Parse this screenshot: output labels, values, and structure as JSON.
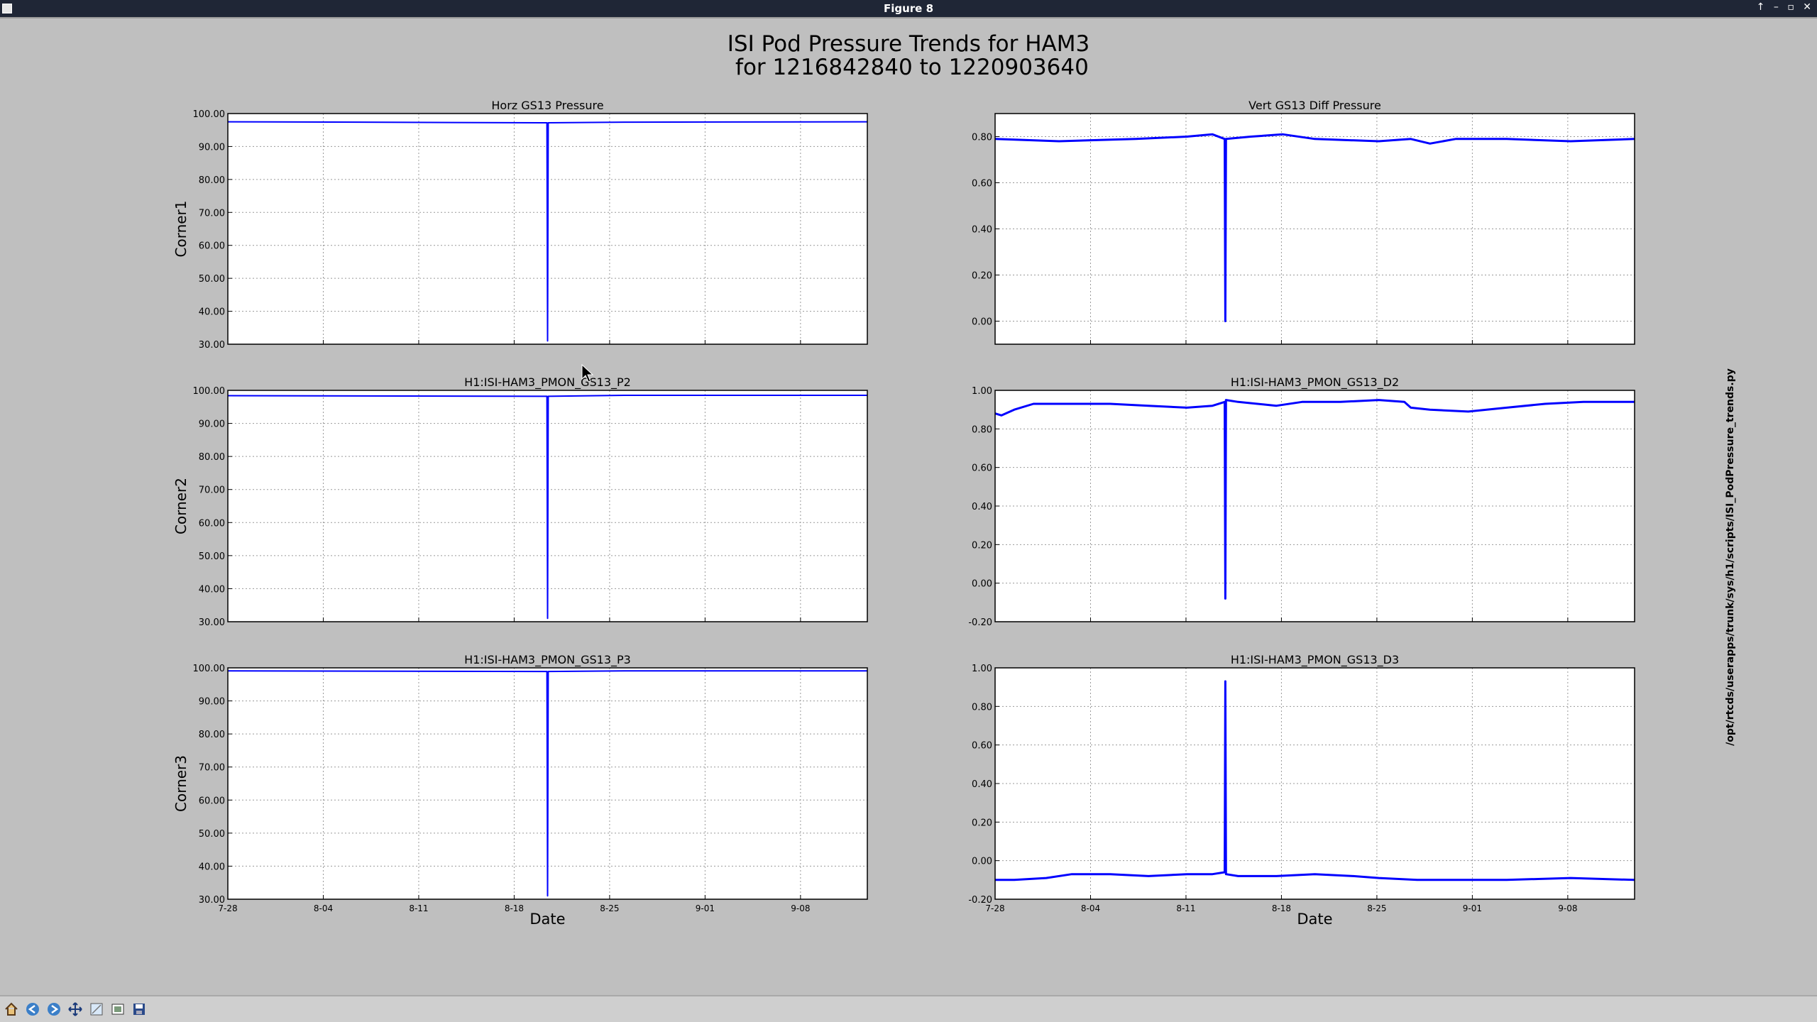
{
  "window": {
    "title": "Figure 8",
    "controls": [
      "↑",
      "–",
      "▫",
      "✕"
    ]
  },
  "figure": {
    "title_line1": "ISI Pod Pressure Trends for HAM3",
    "title_line2": " for 1216842840 to 1220903640",
    "side_text": "/opt/rtcds/userapps/trunk/sys/h1/scripts/ISI_PodPressure_trends.py"
  },
  "toolbar": {
    "icons": [
      "home-icon",
      "back-icon",
      "forward-icon",
      "pan-icon",
      "zoom-icon",
      "configure-icon",
      "save-icon"
    ]
  },
  "colors": {
    "line": "#0000ff",
    "background": "#bfbfbf",
    "plot_bg": "#ffffff"
  },
  "chart_data": [
    {
      "type": "line",
      "title": "Horz GS13 Pressure",
      "ylabel": "Corner1",
      "xlabel": "",
      "ylim": [
        30,
        100
      ],
      "yticks": [
        "30.00",
        "40.00",
        "50.00",
        "60.00",
        "70.00",
        "80.00",
        "90.00",
        "100.00"
      ],
      "xticks": [
        "7-28",
        "8-04",
        "8-11",
        "8-18",
        "8-25",
        "9-01",
        "9-08"
      ],
      "show_xticklabels": false,
      "grid": true,
      "series": [
        {
          "x": [
            0,
            49.9,
            50,
            50.1,
            62,
            100
          ],
          "y": [
            97.5,
            97.2,
            31,
            97.2,
            97.4,
            97.5
          ]
        }
      ]
    },
    {
      "type": "line",
      "title": "Vert GS13 Diff Pressure",
      "ylabel": "",
      "xlabel": "",
      "ylim": [
        -0.1,
        0.9
      ],
      "yticks": [
        "0.00",
        "0.20",
        "0.40",
        "0.60",
        "0.80"
      ],
      "xticks": [
        "7-28",
        "8-04",
        "8-11",
        "8-18",
        "8-25",
        "9-01",
        "9-08"
      ],
      "show_xticklabels": false,
      "grid": true,
      "series": [
        {
          "x": [
            0,
            10,
            22,
            30,
            34,
            35.9,
            36,
            36.1,
            40,
            45,
            50,
            60,
            65,
            68,
            72,
            80,
            90,
            100
          ],
          "y": [
            0.79,
            0.78,
            0.79,
            0.8,
            0.81,
            0.79,
            0.0,
            0.79,
            0.8,
            0.81,
            0.79,
            0.78,
            0.79,
            0.77,
            0.79,
            0.79,
            0.78,
            0.79
          ]
        }
      ]
    },
    {
      "type": "line",
      "title": "H1:ISI-HAM3_PMON_GS13_P2",
      "ylabel": "Corner2",
      "xlabel": "",
      "ylim": [
        30,
        100
      ],
      "yticks": [
        "30.00",
        "40.00",
        "50.00",
        "60.00",
        "70.00",
        "80.00",
        "90.00",
        "100.00"
      ],
      "xticks": [
        "7-28",
        "8-04",
        "8-11",
        "8-18",
        "8-25",
        "9-01",
        "9-08"
      ],
      "show_xticklabels": false,
      "grid": true,
      "series": [
        {
          "x": [
            0,
            49.9,
            50,
            50.1,
            62,
            100
          ],
          "y": [
            98.4,
            98.2,
            31,
            98.2,
            98.5,
            98.5
          ]
        }
      ]
    },
    {
      "type": "line",
      "title": "H1:ISI-HAM3_PMON_GS13_D2",
      "ylabel": "",
      "xlabel": "",
      "ylim": [
        -0.2,
        1.0
      ],
      "yticks": [
        "-0.20",
        "0.00",
        "0.20",
        "0.40",
        "0.60",
        "0.80",
        "1.00"
      ],
      "xticks": [
        "7-28",
        "8-04",
        "8-11",
        "8-18",
        "8-25",
        "9-01",
        "9-08"
      ],
      "show_xticklabels": false,
      "grid": true,
      "series": [
        {
          "x": [
            0,
            1,
            3,
            6,
            12,
            18,
            24,
            30,
            34,
            35.9,
            36,
            36.1,
            38,
            44,
            48,
            54,
            60,
            64,
            65,
            68,
            74,
            80,
            86,
            92,
            100
          ],
          "y": [
            0.88,
            0.87,
            0.9,
            0.93,
            0.93,
            0.93,
            0.92,
            0.91,
            0.92,
            0.94,
            -0.08,
            0.95,
            0.94,
            0.92,
            0.94,
            0.94,
            0.95,
            0.94,
            0.91,
            0.9,
            0.89,
            0.91,
            0.93,
            0.94,
            0.94
          ]
        }
      ]
    },
    {
      "type": "line",
      "title": "H1:ISI-HAM3_PMON_GS13_P3",
      "ylabel": "Corner3",
      "xlabel": "Date",
      "ylim": [
        30,
        100
      ],
      "yticks": [
        "30.00",
        "40.00",
        "50.00",
        "60.00",
        "70.00",
        "80.00",
        "90.00",
        "100.00"
      ],
      "xticks": [
        "7-28",
        "8-04",
        "8-11",
        "8-18",
        "8-25",
        "9-01",
        "9-08"
      ],
      "show_xticklabels": true,
      "grid": true,
      "series": [
        {
          "x": [
            0,
            49.9,
            50,
            50.1,
            62,
            100
          ],
          "y": [
            99.1,
            98.9,
            31,
            98.9,
            99.1,
            99.1
          ]
        }
      ]
    },
    {
      "type": "line",
      "title": "H1:ISI-HAM3_PMON_GS13_D3",
      "ylabel": "",
      "xlabel": "Date",
      "ylim": [
        -0.2,
        1.0
      ],
      "yticks": [
        "-0.20",
        "0.00",
        "0.20",
        "0.40",
        "0.60",
        "0.80",
        "1.00"
      ],
      "xticks": [
        "7-28",
        "8-04",
        "8-11",
        "8-18",
        "8-25",
        "9-01",
        "9-08"
      ],
      "show_xticklabels": true,
      "grid": true,
      "series": [
        {
          "x": [
            0,
            3,
            8,
            12,
            18,
            24,
            30,
            34,
            35.9,
            36,
            36.1,
            38,
            44,
            50,
            56,
            60,
            66,
            72,
            80,
            90,
            100
          ],
          "y": [
            -0.1,
            -0.1,
            -0.09,
            -0.07,
            -0.07,
            -0.08,
            -0.07,
            -0.07,
            -0.06,
            0.93,
            -0.07,
            -0.08,
            -0.08,
            -0.07,
            -0.08,
            -0.09,
            -0.1,
            -0.1,
            -0.1,
            -0.09,
            -0.1
          ]
        }
      ]
    }
  ]
}
